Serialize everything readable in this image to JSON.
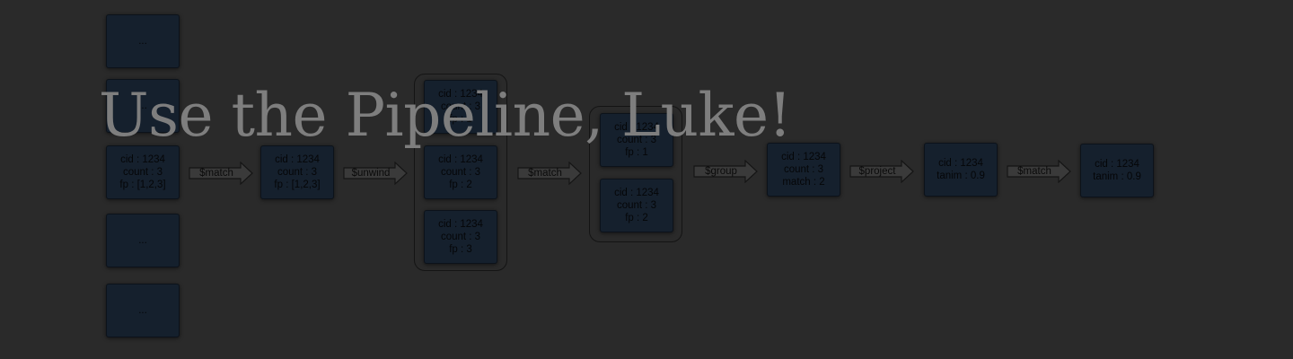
{
  "title": "Use the Pipeline, Luke!",
  "colors": {
    "background": "#2a2a2a",
    "box_fill": "#15202d",
    "title_text": "#7e7e7e"
  },
  "column1": {
    "top": "...",
    "second": "...",
    "doc": {
      "l1": "cid : 1234",
      "l2": "count : 3",
      "l3": "fp : [1,2,3]"
    },
    "fourth": "...",
    "fifth": "..."
  },
  "stages": {
    "match1": "$match",
    "unwind": "$unwind",
    "match2": "$match",
    "group": "$group",
    "project": "$project",
    "match3": "$match"
  },
  "after_match1": {
    "l1": "cid : 1234",
    "l2": "count : 3",
    "l3": "fp : [1,2,3]"
  },
  "unwound": [
    {
      "l1": "cid : 1234",
      "l2": "count : 3",
      "l3": "fp : 1"
    },
    {
      "l1": "cid : 1234",
      "l2": "count : 3",
      "l3": "fp : 2"
    },
    {
      "l1": "cid : 1234",
      "l2": "count : 3",
      "l3": "fp : 3"
    }
  ],
  "matched": [
    {
      "l1": "cid : 1234",
      "l2": "count : 3",
      "l3": "fp : 1"
    },
    {
      "l1": "cid : 1234",
      "l2": "count : 3",
      "l3": "fp : 2"
    }
  ],
  "grouped": {
    "l1": "cid : 1234",
    "l2": "count : 3",
    "l3": "match : 2"
  },
  "projected": {
    "l1": "cid : 1234",
    "l2": "tanim : 0.9"
  },
  "final": {
    "l1": "cid : 1234",
    "l2": "tanim : 0.9"
  }
}
